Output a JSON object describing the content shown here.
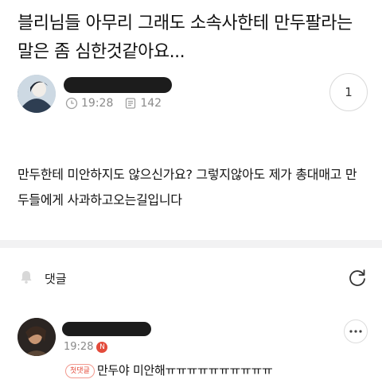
{
  "post": {
    "title": "블리님들 아무리 그래도 소속사한테 만두팔라는 말은 좀 심한것같아요...",
    "time": "19:28",
    "views": "142",
    "comment_count": "1",
    "body": "만두한테 미안하지도 않으신가요? 그렇지않아도 제가 총대매고 만두들에게 사과하고오는길입니다"
  },
  "comments": {
    "label": "댓글",
    "items": [
      {
        "time": "19:28",
        "new_badge": "N",
        "first_badge": "첫댓글",
        "text": "만두야 미안해ㅠㅠㅠㅠㅠㅠㅠㅠㅠㅠ"
      }
    ]
  },
  "icons": {
    "clock": "clock-icon",
    "views": "document-icon",
    "bell": "bell-icon",
    "refresh": "refresh-icon",
    "more": "more-icon"
  }
}
